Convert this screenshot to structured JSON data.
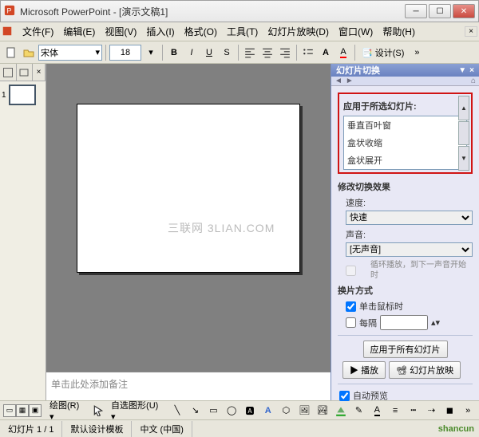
{
  "titlebar": {
    "title": "Microsoft PowerPoint - [演示文稿1]"
  },
  "menu": {
    "file": "文件(F)",
    "edit": "编辑(E)",
    "view": "视图(V)",
    "insert": "插入(I)",
    "format": "格式(O)",
    "tools": "工具(T)",
    "slideshow": "幻灯片放映(D)",
    "window": "窗口(W)",
    "help": "帮助(H)"
  },
  "toolbar": {
    "font_name": "宋体",
    "font_size": "18",
    "bold": "B",
    "italic": "I",
    "underline": "U",
    "shadow": "S",
    "font_label_A": "A",
    "design_btn": "设计(S)"
  },
  "outline": {
    "slide_num": "1"
  },
  "editor": {
    "notes_placeholder": "单击此处添加备注"
  },
  "taskpane": {
    "title": "幻灯片切换",
    "apply_label": "应用于所选幻灯片:",
    "transitions": [
      "垂直百叶窗",
      "盒状收缩",
      "盒状展开"
    ],
    "modify_label": "修改切换效果",
    "speed_label": "速度:",
    "speed_value": "快速",
    "sound_label": "声音:",
    "sound_value": "[无声音]",
    "loop_note": "循环播放，到下一声音开始时",
    "advance_label": "换片方式",
    "on_click": "单击鼠标时",
    "every": "每隔",
    "apply_all_btn": "应用于所有幻灯片",
    "play_btn": "播放",
    "slideshow_btn": "幻灯片放映",
    "auto_preview": "自动预览"
  },
  "drawbar": {
    "draw_label": "绘图(R)",
    "autoshape_label": "自选图形(U)"
  },
  "statusbar": {
    "slide_info": "幻灯片 1 / 1",
    "template": "默认设计模板",
    "lang": "中文 (中国)"
  },
  "watermark": "三联网 3LIAN.COM",
  "brand": "shancun"
}
